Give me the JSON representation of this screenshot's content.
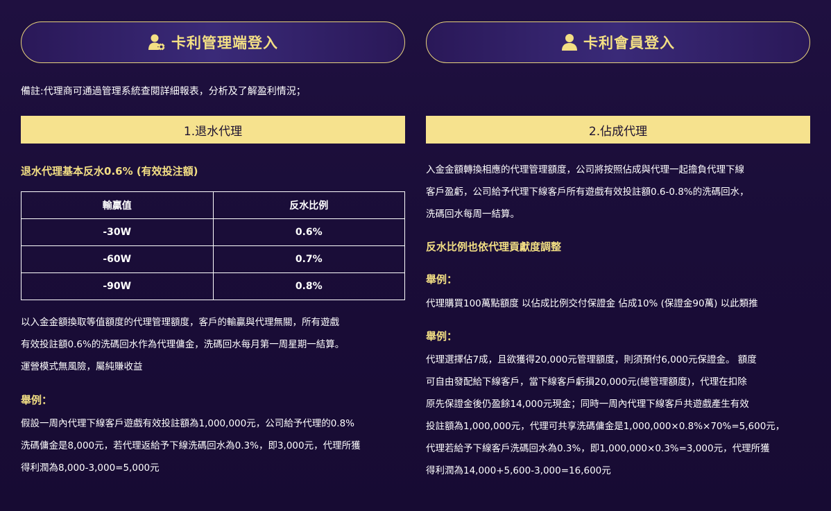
{
  "left": {
    "login_label": "卡利管理端登入",
    "note": "備註:代理商可通過管理系統查閱詳細報表，分析及了解盈利情況；",
    "section_title": "1.退水代理",
    "heading": "退水代理基本反水0.6% (有效投注額)",
    "table": {
      "headers": [
        "輸贏值",
        "反水比例"
      ],
      "rows": [
        [
          "-30W",
          "0.6%"
        ],
        [
          "-60W",
          "0.7%"
        ],
        [
          "-90W",
          "0.8%"
        ]
      ]
    },
    "desc_lines": [
      "以入金金額換取等值額度的代理管理額度，客戶的輸贏與代理無關，所有遊戲",
      "有效投註額0.6%的洗碼回水作為代理傭金，洗碼回水每月第一周星期一結算。",
      "運營模式無風險，屬純賺收益"
    ],
    "example_label": "舉例：",
    "example_lines": [
      "假設一周內代理下線客戶遊戲有效投註額為1,000,000元，公司給予代理的0.8%",
      "洗碼傭金是8,000元，若代理返給予下線洗碼回水為0.3%，即3,000元，代理所獲",
      "得利潤為8,000-3,000=5,000元"
    ]
  },
  "right": {
    "login_label": "卡利會員登入",
    "section_title": "2.佔成代理",
    "intro_lines": [
      "入金金額轉換相應的代理管理額度，公司將按照佔成與代理一起擔負代理下線",
      "客戶盈虧，公司給予代理下線客戶所有遊戲有效投註額0.6-0.8%的洗碼回水，",
      "洗碼回水每周一結算。"
    ],
    "heading": "反水比例也依代理貢獻度調整",
    "example1_label": "舉例：",
    "example1_text": "代理購買100萬點額度 以佔成比例交付保證金 佔成10% (保證金90萬) 以此類推",
    "example2_label": "舉例：",
    "example2_lines": [
      "代理選擇佔7成，且欲獲得20,000元管理額度，則須預付6,000元保證金。 額度",
      "可自由發配給下線客戶，當下線客戶虧損20,000元(總管理額度)，代理在扣除",
      "原先保證金後仍盈餘14,000元現金；同時一周內代理下線客戶共遊戲產生有效",
      "投註額為1,000,000元，代理可共享洗碼傭金是1,000,000×0.8%×70%=5,600元，",
      "代理若給予下線客戶洗碼回水為0.3%，即1,000,000×0.3%=3,000元，代理所獲",
      "得利潤為14,000+5,600-3,000=16,600元"
    ]
  },
  "colors": {
    "accent_gold": "#f3df84",
    "bar_yellow": "#f6e28e",
    "background": "#1c0e3a"
  }
}
